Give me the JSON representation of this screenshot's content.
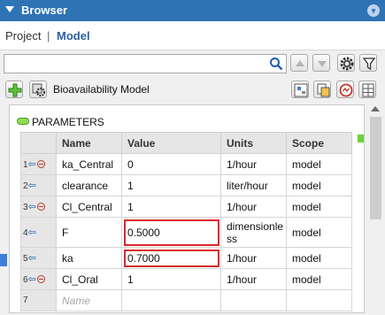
{
  "titlebar": {
    "title": "Browser",
    "menu_icon": "chevron-down-icon"
  },
  "breadcrumb": {
    "project": "Project",
    "separator": "|",
    "model": "Model"
  },
  "search": {
    "value": "",
    "placeholder": ""
  },
  "toolbar": {
    "model_name": "Bioavailability Model"
  },
  "parameters": {
    "header": "PARAMETERS",
    "columns": [
      "Name",
      "Value",
      "Units",
      "Scope"
    ],
    "rows": [
      {
        "num": "1",
        "name": "ka_Central",
        "value": "0",
        "units": "1/hour",
        "scope": "model"
      },
      {
        "num": "2",
        "name": "clearance",
        "value": "1",
        "units": "liter/hour",
        "scope": "model"
      },
      {
        "num": "3",
        "name": "Cl_Central",
        "value": "1",
        "units": "1/hour",
        "scope": "model"
      },
      {
        "num": "4",
        "name": "F",
        "value": "0.5000",
        "units": "dimensionless",
        "scope": "model"
      },
      {
        "num": "5",
        "name": "ka",
        "value": "0.7000",
        "units": "1/hour",
        "scope": "model"
      },
      {
        "num": "6",
        "name": "Cl_Oral",
        "value": "1",
        "units": "1/hour",
        "scope": "model"
      },
      {
        "num": "7",
        "name": "",
        "value": "",
        "units": "",
        "scope": ""
      }
    ],
    "new_row_placeholder": "Name"
  },
  "colors": {
    "titlebar": "#2e74b5",
    "highlight": "#d9292e",
    "pill": "#8fdc55"
  }
}
